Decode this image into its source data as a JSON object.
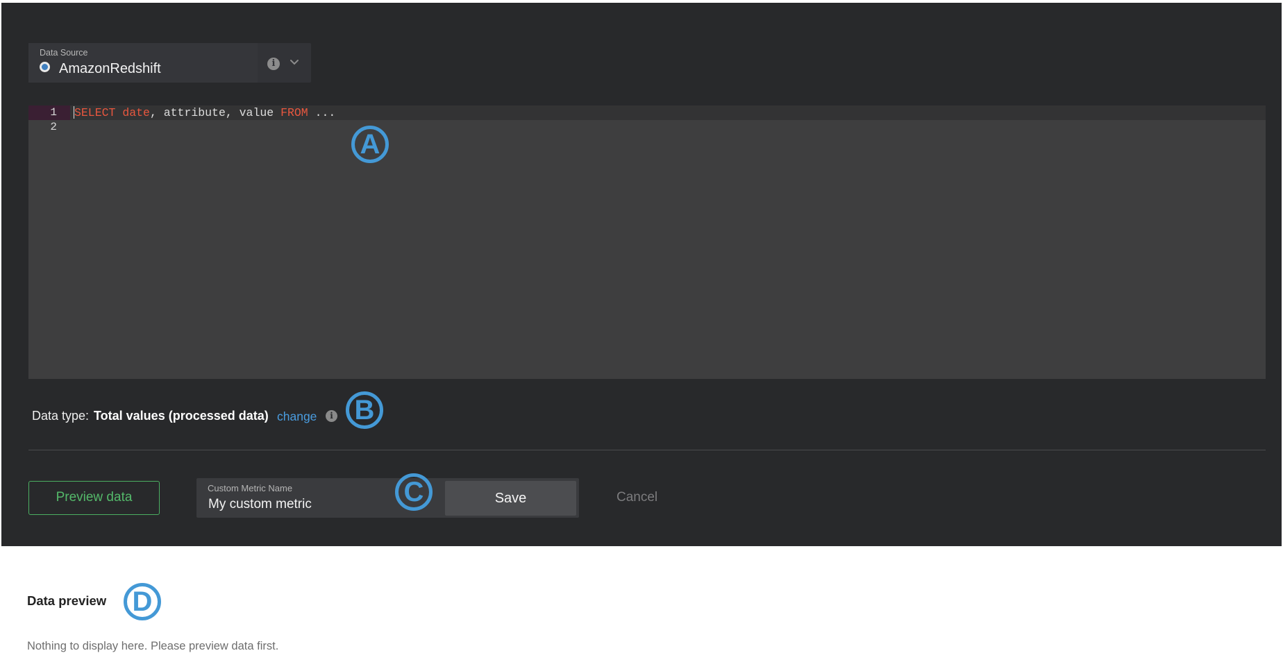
{
  "data_source": {
    "label": "Data Source",
    "value": "AmazonRedshift"
  },
  "editor": {
    "line_numbers": [
      "1",
      "2"
    ],
    "line1": {
      "kw_select": "SELECT",
      "col_date": "date",
      "rest": ", attribute, value ",
      "kw_from": "FROM",
      "tail": " ..."
    }
  },
  "data_type": {
    "label": "Data type:",
    "value": "Total values (processed data)",
    "change_link": "change"
  },
  "controls": {
    "preview_button": "Preview data",
    "metric_name_label": "Custom Metric Name",
    "metric_name_value": "My custom metric",
    "save_button": "Save",
    "cancel_button": "Cancel"
  },
  "preview": {
    "title": "Data preview",
    "empty_message": "Nothing to display here. Please preview data first."
  },
  "callouts": [
    "A",
    "B",
    "C",
    "D"
  ],
  "colors": {
    "panel_bg": "#28292b",
    "keyword": "#e8573f",
    "link": "#4a9de0",
    "preview_green": "#54b96a",
    "callout_blue": "#4499d6"
  }
}
